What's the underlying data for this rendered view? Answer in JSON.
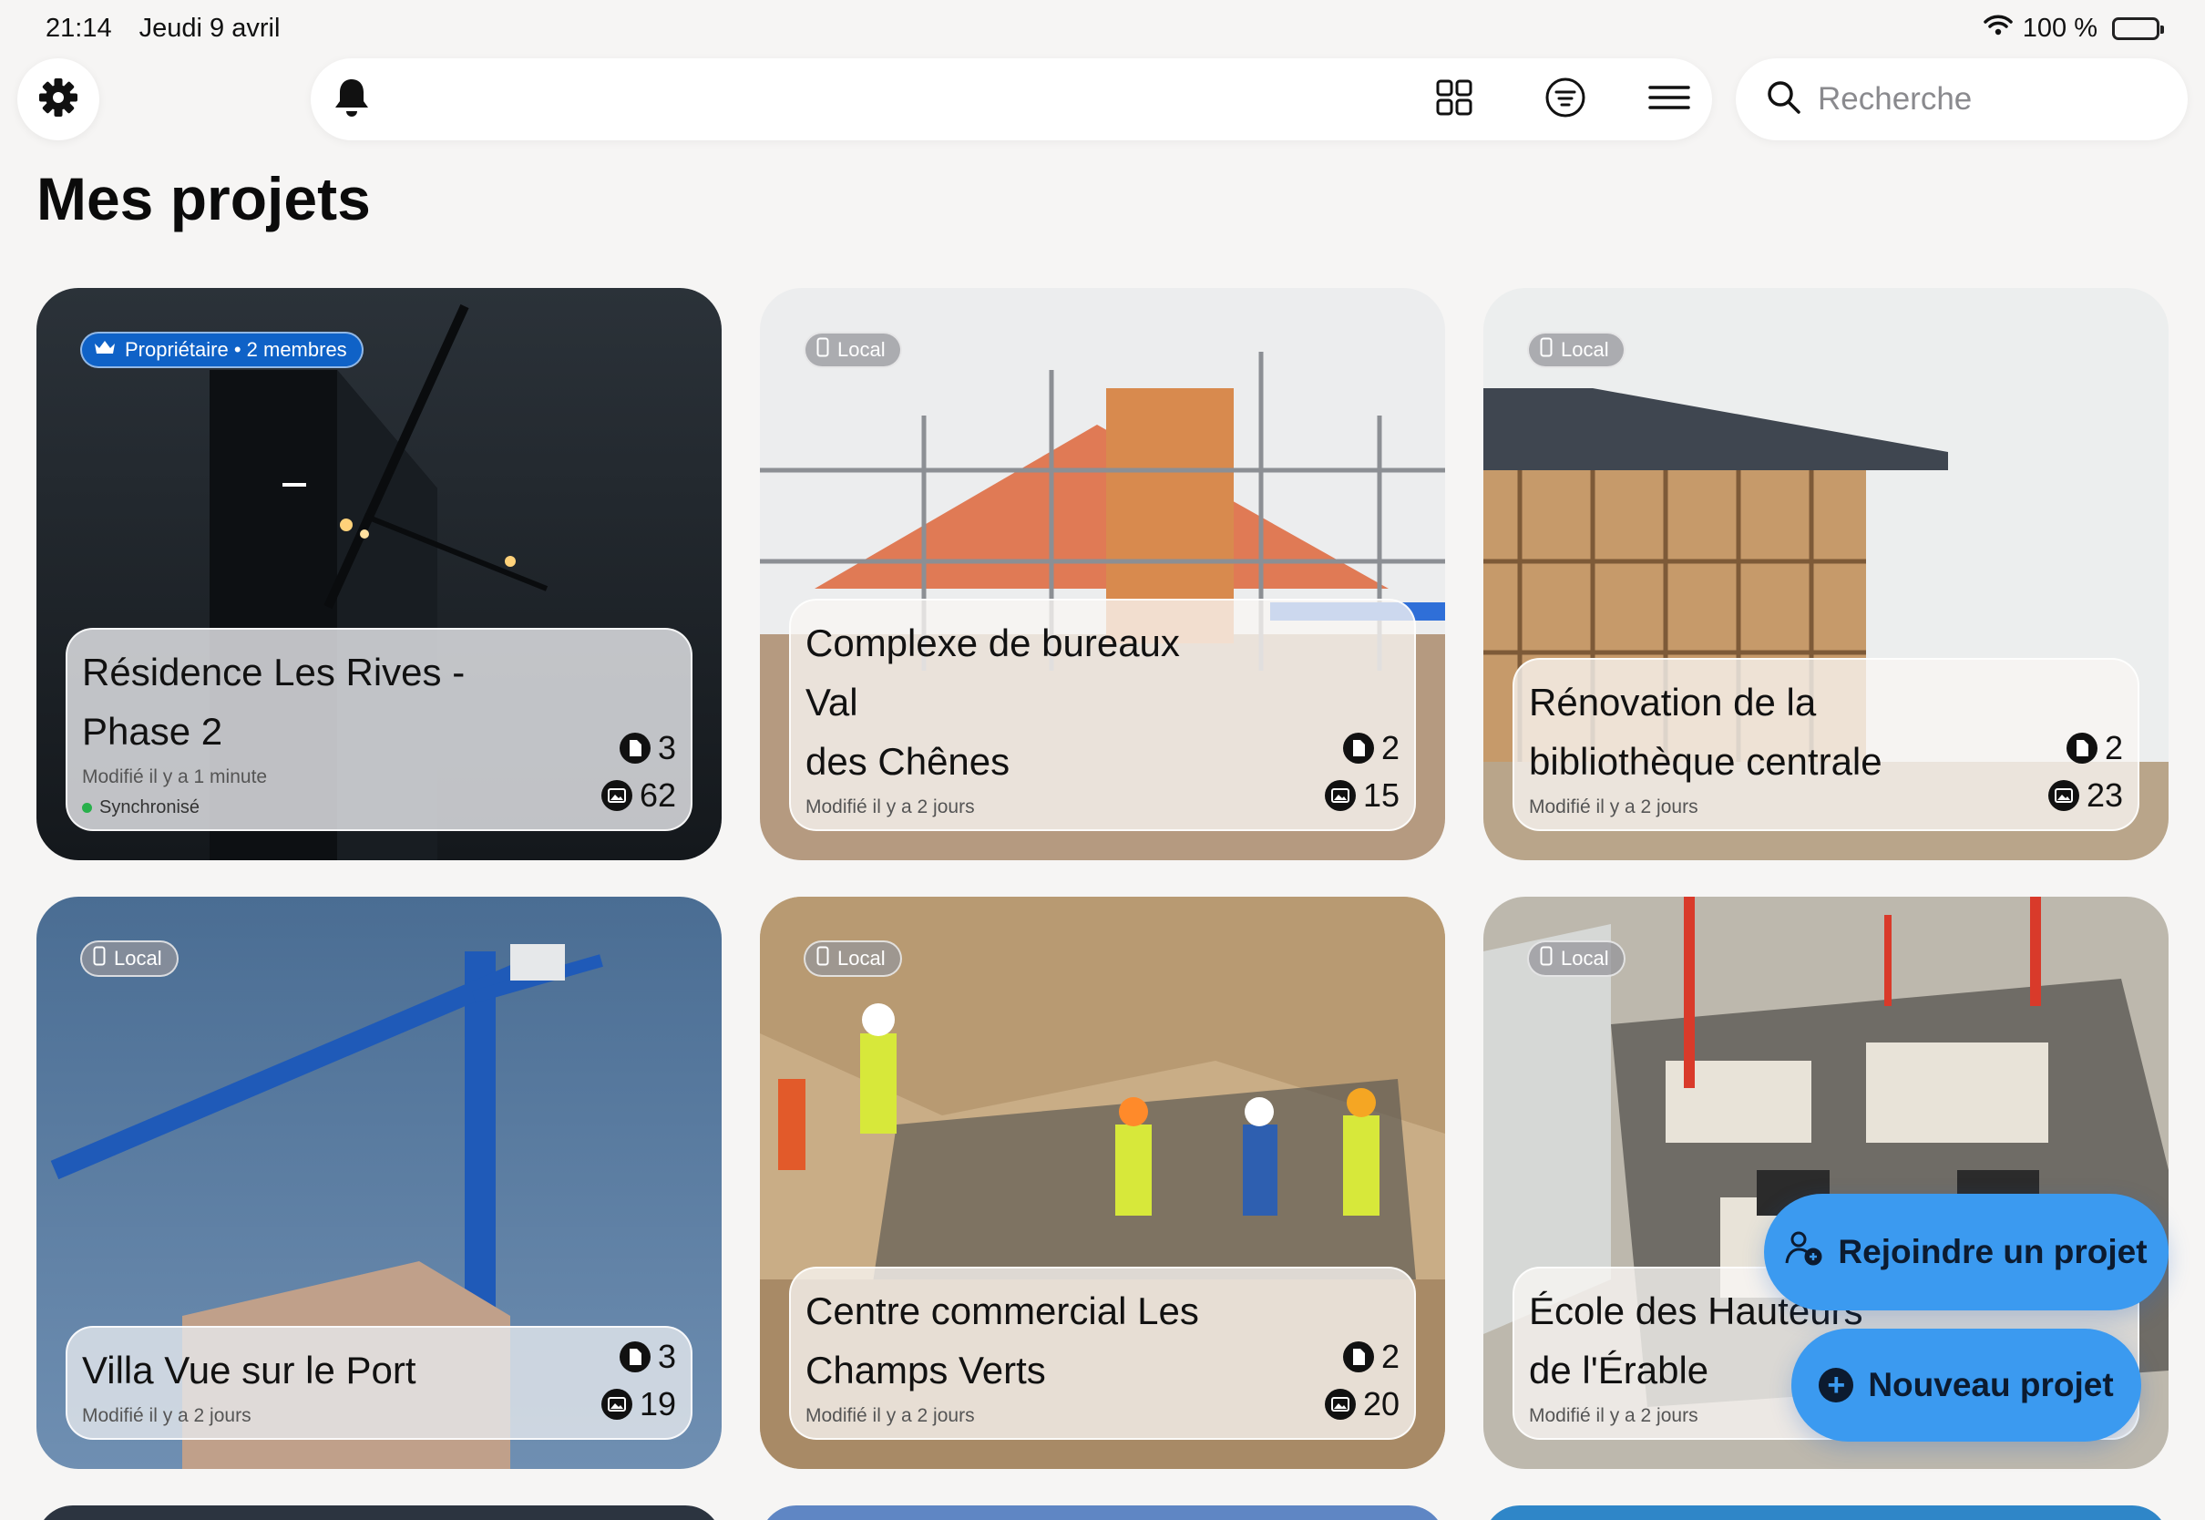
{
  "status_bar": {
    "time": "21:14",
    "date": "Jeudi 9 avril",
    "battery": "100 %"
  },
  "search": {
    "placeholder": "Recherche"
  },
  "page_title": "Mes projets",
  "projects": [
    {
      "badge": "Propriétaire • 2 membres",
      "name_line1": "Résidence Les Rives -",
      "name_line2": "Phase 2",
      "modified": "Modifié il y a 1 minute",
      "sync": "Synchronisé",
      "docs": "3",
      "photos": "62"
    },
    {
      "badge": "Local",
      "name_line1": "Complexe de bureaux Val",
      "name_line2": "des Chênes",
      "modified": "Modifié il y a 2 jours",
      "docs": "2",
      "photos": "15"
    },
    {
      "badge": "Local",
      "name_line1": "Rénovation de la",
      "name_line2": "bibliothèque centrale",
      "modified": "Modifié il y a 2 jours",
      "docs": "2",
      "photos": "23"
    },
    {
      "badge": "Local",
      "name_line1": "Villa Vue sur le Port",
      "name_line2": "",
      "modified": "Modifié il y a 2 jours",
      "docs": "3",
      "photos": "19"
    },
    {
      "badge": "Local",
      "name_line1": "Centre commercial Les",
      "name_line2": "Champs Verts",
      "modified": "Modifié il y a 2 jours",
      "docs": "2",
      "photos": "20"
    },
    {
      "badge": "Local",
      "name_line1": "École des Hauteurs",
      "name_line2": "de l'Érable",
      "modified": "Modifié il y a 2 jours",
      "docs": "",
      "photos": ""
    }
  ],
  "actions": {
    "join_label": "Rejoindre un projet",
    "new_label": "Nouveau projet"
  },
  "colors": {
    "accent": "#3b9af0",
    "owner_badge": "#0f62c7",
    "sync_dot": "#28b04b"
  }
}
